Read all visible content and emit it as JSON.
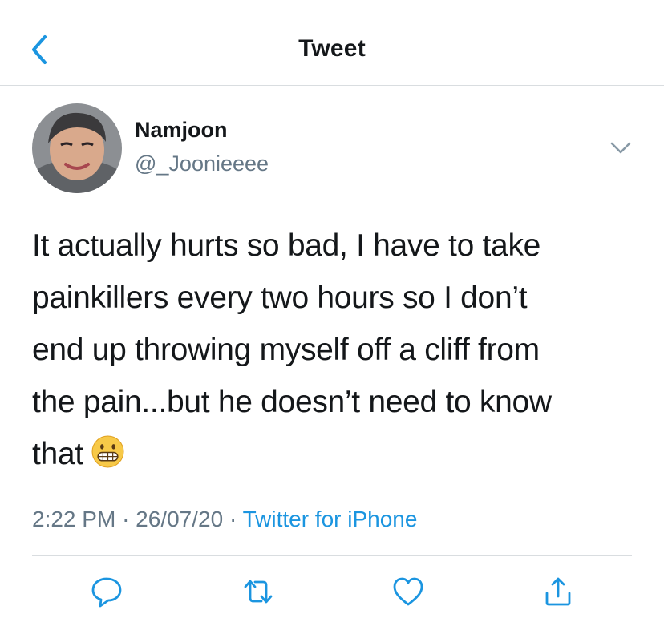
{
  "header": {
    "title": "Tweet",
    "back_icon": "chevron-left-icon"
  },
  "tweet": {
    "author_name": "Namjoon",
    "author_handle": "@_Joonieeee",
    "text_lines": [
      "It actually hurts so bad, I have to take",
      "painkillers every two hours so I don’t",
      "end up throwing myself off a cliff from",
      "the pain...but he doesn’t need to know",
      "that"
    ],
    "emoji": "grimacing-face",
    "time": "2:22 PM",
    "date": "26/07/20",
    "separator": "·",
    "source": "Twitter for iPhone"
  },
  "actions": [
    "reply-icon",
    "retweet-icon",
    "like-icon",
    "share-icon"
  ],
  "colors": {
    "accent": "#1b95e0",
    "muted": "#657786",
    "icon": "#1b95e0"
  }
}
